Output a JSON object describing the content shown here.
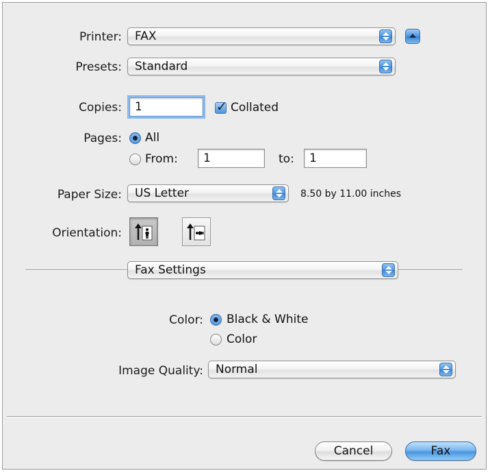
{
  "printer": {
    "label": "Printer:",
    "value": "FAX"
  },
  "presets": {
    "label": "Presets:",
    "value": "Standard"
  },
  "copies": {
    "label": "Copies:",
    "value": "1",
    "collated_label": "Collated",
    "collated_checked": true
  },
  "pages": {
    "label": "Pages:",
    "all_label": "All",
    "from_label": "From:",
    "from_value": "1",
    "to_label": "to:",
    "to_value": "1",
    "selected": "All"
  },
  "paper_size": {
    "label": "Paper Size:",
    "value": "US Letter",
    "dimensions": "8.50 by 11.00 inches"
  },
  "orientation": {
    "label": "Orientation:",
    "selected": "portrait"
  },
  "section": {
    "value": "Fax Settings"
  },
  "color": {
    "label": "Color:",
    "bw_label": "Black & White",
    "color_label": "Color",
    "selected": "Black & White"
  },
  "image_quality": {
    "label": "Image Quality:",
    "value": "Normal"
  },
  "buttons": {
    "cancel": "Cancel",
    "fax": "Fax"
  },
  "colors": {
    "accent": "#4b96e0",
    "dialog_bg": "#ececec",
    "focus_ring": "#8ab8ea"
  },
  "icons": [
    "up-arrow-icon",
    "popup-arrows-icon",
    "checkmark-icon",
    "portrait-icon",
    "landscape-icon"
  ]
}
